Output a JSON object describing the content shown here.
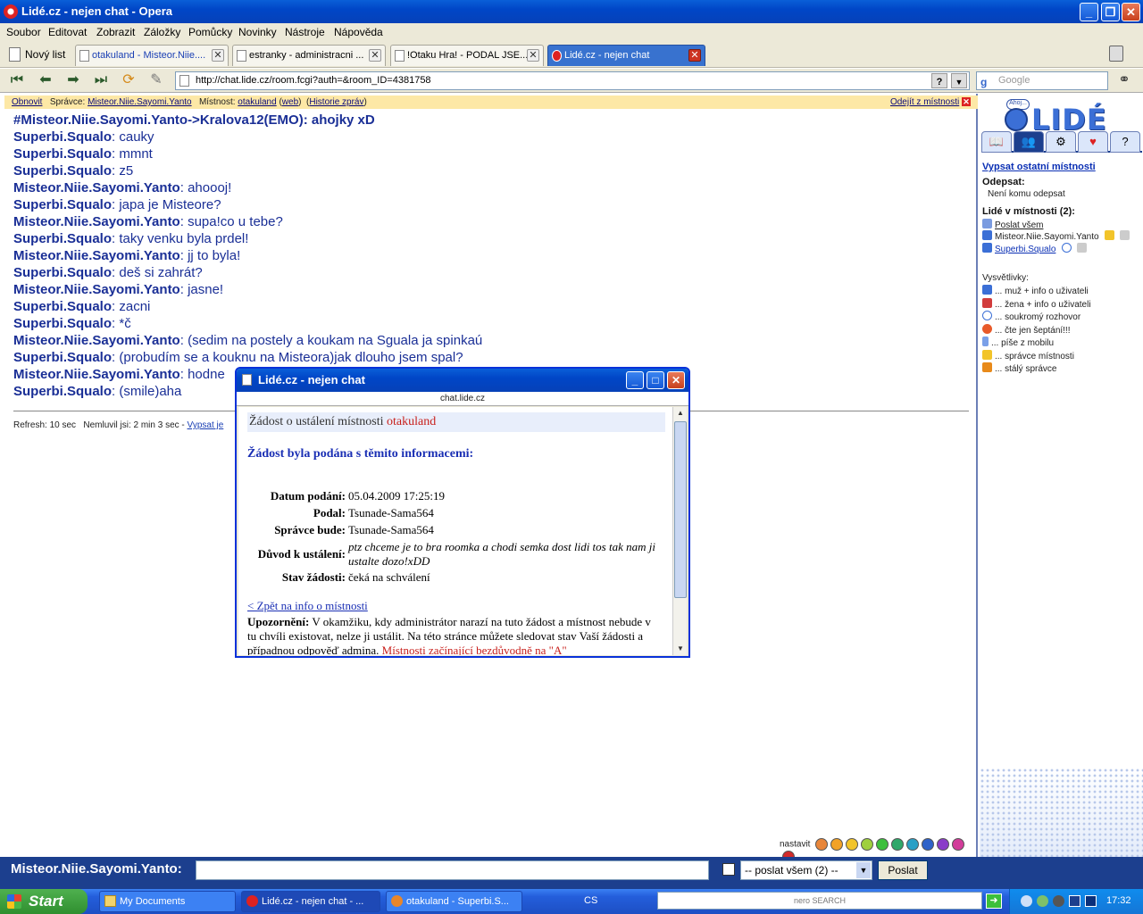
{
  "window": {
    "title": "Lidé.cz - nejen chat - Opera"
  },
  "menu": [
    "Soubor",
    "Editovat",
    "Zobrazit",
    "Záložky",
    "Pomůcky",
    "Novinky",
    "Nástroje",
    "Nápověda"
  ],
  "tabs": {
    "new_tab": "Nový list",
    "items": [
      {
        "label": "otakuland - Misteor.Niie....",
        "link": true
      },
      {
        "label": "estranky - administracni ..."
      },
      {
        "label": "!Otaku Hra! - PODAL JSE..."
      },
      {
        "label": "Lidé.cz - nejen chat",
        "active": true
      }
    ]
  },
  "address": {
    "url": "http://chat.lide.cz/room.fcgi?auth=&room_ID=4381758",
    "search_placeholder": "Google"
  },
  "infobar": {
    "refresh": "Obnovit",
    "admin_label": "Správce:",
    "admin": "Misteor.Niie.Sayomi.Yanto",
    "room_label": "Místnost:",
    "room": "otakuland",
    "web": "web",
    "history": "Historie zpráv",
    "leave": "Odejít z místnosti"
  },
  "messages": [
    {
      "nick": "#Misteor.Niie.Sayomi.Yanto->Kralova12(EMO): ahojky xD",
      "text": "",
      "header": true
    },
    {
      "nick": "Superbi.Squalo",
      "text": ": cauky"
    },
    {
      "nick": "Superbi.Squalo",
      "text": ": mmnt"
    },
    {
      "nick": "Superbi.Squalo",
      "text": ": z5"
    },
    {
      "nick": "Misteor.Niie.Sayomi.Yanto",
      "text": ": ahoooj!"
    },
    {
      "nick": "Superbi.Squalo",
      "text": ": japa je Misteore?"
    },
    {
      "nick": "Misteor.Niie.Sayomi.Yanto",
      "text": ": supa!co u tebe?"
    },
    {
      "nick": "Superbi.Squalo",
      "text": ": taky venku byla prdel!"
    },
    {
      "nick": "Misteor.Niie.Sayomi.Yanto",
      "text": ": jj to byla!"
    },
    {
      "nick": "Superbi.Squalo",
      "text": ": deš si zahrát?"
    },
    {
      "nick": "Misteor.Niie.Sayomi.Yanto",
      "text": ": jasne!"
    },
    {
      "nick": "Superbi.Squalo",
      "text": ": zacni"
    },
    {
      "nick": "Superbi.Squalo",
      "text": ": *č"
    },
    {
      "nick": "Misteor.Niie.Sayomi.Yanto",
      "text": ": (sedim na postely a koukam na Sguala ja spinkaú"
    },
    {
      "nick": "Superbi.Squalo",
      "text": ": (probudím se a kouknu na Misteora)jak dlouho jsem spal?"
    },
    {
      "nick": "Misteor.Niie.Sayomi.Yanto",
      "text": ": hodne"
    },
    {
      "nick": "Superbi.Squalo",
      "text": ": (smile)aha"
    }
  ],
  "status": {
    "refresh": "Refresh: 10 sec",
    "silent": "Nemluvil jsi: 2 min 3 sec -",
    "link": "Vypsat je"
  },
  "smileys": {
    "label": "nastavit",
    "colors": [
      "#e8863a",
      "#f2a227",
      "#f2c42a",
      "#9fd03c",
      "#3cbf3c",
      "#2fa86a",
      "#2aa0c6",
      "#2e62c9",
      "#8a3cc9",
      "#d23c9a",
      "#d22a2a"
    ]
  },
  "sidebar": {
    "list_rooms": "Vypsat ostatní místnosti",
    "reply_title": "Odepsat:",
    "reply_text": "Není komu odepsat",
    "people_title": "Lidé v místnosti (2):",
    "send_all": "Poslat všem",
    "people": [
      "Misteor.Niie.Sayomi.Yanto",
      "Superbi.Squalo"
    ],
    "legend_title": "Vysvětlivky:",
    "legend": [
      "... muž + info o uživateli",
      "... žena + info o uživateli",
      "... soukromý rozhovor",
      "... čte jen šeptání!!!",
      "... píše z mobilu",
      "... správce místnosti",
      "... stálý správce"
    ],
    "logo_text": "LIDÉ",
    "logo_badge": "Ahoj..."
  },
  "input": {
    "nick": "Misteor.Niie.Sayomi.Yanto:",
    "target": "-- poslat všem (2) --",
    "send": "Poslat"
  },
  "popup": {
    "title": "Lidé.cz - nejen chat",
    "url": "chat.lide.cz",
    "heading": "Žádost o ustálení místnosti",
    "room": "otakuland",
    "subheading": "Žádost byla podána s těmito informacemi:",
    "fields": [
      {
        "k": "Datum podání:",
        "v": "05.04.2009 17:25:19"
      },
      {
        "k": "Podal:",
        "v": "Tsunade-Sama564"
      },
      {
        "k": "Správce bude:",
        "v": "Tsunade-Sama564"
      },
      {
        "k": "Důvod k ustálení:",
        "v": "ptz chceme je to bra roomka a chodi semka dost lidi tos tak nam ji ustalte dozo!xDD",
        "italic": true
      },
      {
        "k": "Stav žádosti:",
        "v": "čeká na schválení"
      }
    ],
    "back": "< Zpět na info o místnosti",
    "warn_label": "Upozornění:",
    "warn_text": " V okamžiku, kdy administrátor narazí na tuto žádost a místnost nebude v tu chvíli existovat, nelze ji ustálit. Na této stránce můžete sledovat stav Vaší žádosti a případnou odpověď admina. ",
    "warn_red": "Místnosti začínající bezdůvodně na \"A\""
  },
  "taskbar": {
    "start": "Start",
    "tasks": [
      {
        "label": "My Documents"
      },
      {
        "label": "Lidé.cz - nejen chat - ...",
        "active": true
      },
      {
        "label": "otakuland - Superbi.S..."
      }
    ],
    "lang": "CS",
    "search": "nero SEARCH",
    "time": "17:32"
  }
}
